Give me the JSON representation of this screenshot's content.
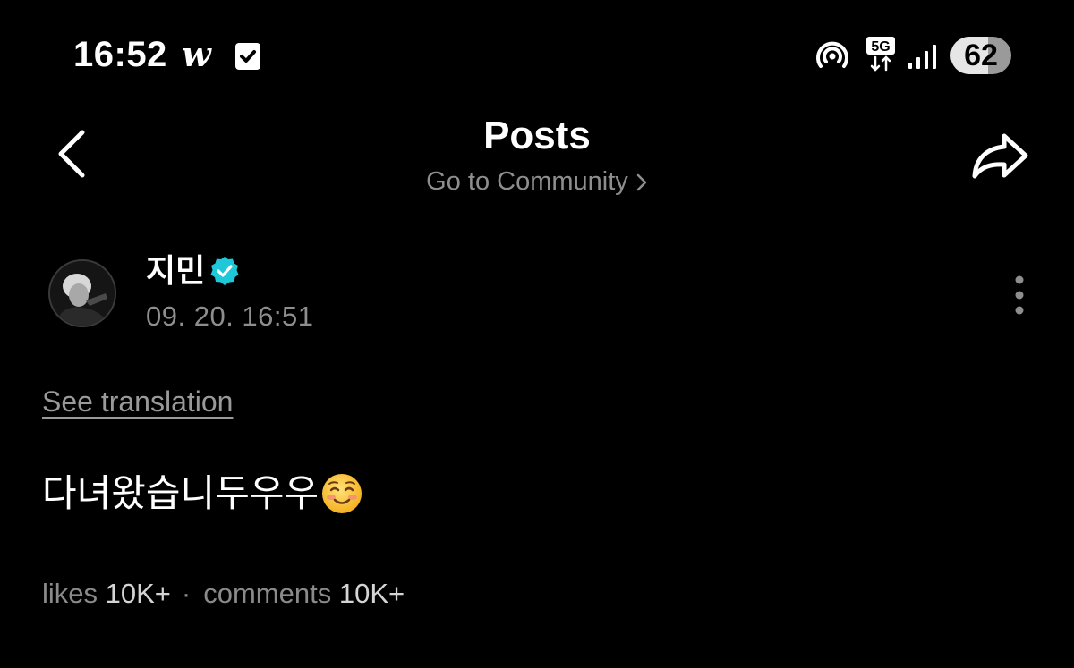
{
  "status_bar": {
    "time": "16:52",
    "app_glyph": "w",
    "battery": "62",
    "network": "5G",
    "icons": [
      "w-app-icon",
      "checkbox-icon",
      "hotspot-icon",
      "5g-icon",
      "signal-icon",
      "battery-icon"
    ]
  },
  "header": {
    "title": "Posts",
    "community_link": "Go to Community",
    "back_icon": "chevron-left-icon",
    "share_icon": "share-icon"
  },
  "post": {
    "author": "지민",
    "timestamp": "09. 20. 16:51",
    "see_translation": "See translation",
    "body": "다녀왔습니두우우",
    "emoji": "smiling-face-icon",
    "stats": {
      "likes_label": "likes",
      "likes_value": "10K+",
      "separator": "·",
      "comments_label": "comments",
      "comments_value": "10K+"
    }
  },
  "colors": {
    "background": "#000000",
    "text": "#ffffff",
    "muted": "#8e8e8e",
    "verified": "#1ec8d8"
  }
}
